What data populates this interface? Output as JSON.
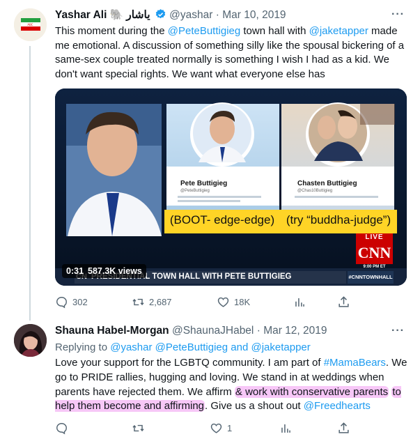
{
  "tweet1": {
    "name": "Yashar Ali 🐘 یاشار",
    "handle": "@yashar",
    "date": "Mar 10, 2019",
    "text_parts": [
      "This moment during the ",
      "@PeteButtigieg",
      " town hall with ",
      "@jaketapper",
      " made me emotional. A discussion of something silly like the spousal bickering of a same-sex couple treated normally is something I wish I had as a kid. We don't want special rights. We want what everyone else has"
    ],
    "media": {
      "card1_name": "Pete Buttigieg",
      "card1_handle": "@PeteButtigieg",
      "card2_name": "Chasten Buttigieg",
      "card2_handle": "@Chas10Buttigieg",
      "caption1": "(BOOT- edge-edge)",
      "caption2": "(try “buddha-judge”)",
      "live": "LIVE",
      "network": "CNN",
      "time": "9:00 PM ET",
      "banner": "PRESIDENTIAL TOWN HALL WITH PETE BUTTIGIEG",
      "banner_prefix": "CN",
      "hashtag": "#CNNTOWNHALL",
      "duration": "0:31",
      "views": "587.3K views"
    },
    "actions": {
      "replies": "302",
      "retweets": "2,687",
      "likes": "18K"
    }
  },
  "tweet2": {
    "name": "Shauna Habel-Morgan",
    "handle": "@ShaunaJHabel",
    "date": "Mar 12, 2019",
    "reply_prefix": "Replying to ",
    "reply_users": [
      "@yashar",
      "@PeteButtigieg",
      "@jaketapper"
    ],
    "reply_and": " and ",
    "text_1": "Love your support for the LGBTQ community. I am part of ",
    "hashtag": "#MamaBears",
    "text_2": ". We go to PRIDE rallies, hugging and loving. We stand in at weddings when parents have rejected them. We affirm ",
    "highlight_1": "& work with conservative parents",
    "highlight_2": "to help them become and affirming",
    "text_3": ". Give us a shout out ",
    "mention": "@Freedhearts",
    "actions": {
      "likes": "1"
    }
  },
  "more_icon": "···",
  "colors": {
    "link": "#1d9bf0",
    "muted": "#536471",
    "highlight": "#ee82ee",
    "cnn_red": "#cc0000"
  }
}
